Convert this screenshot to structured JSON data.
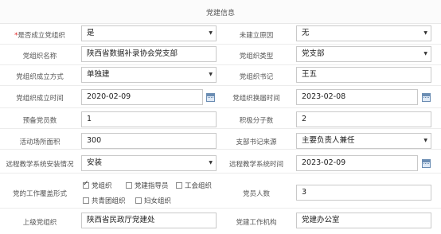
{
  "section_title": "党建信息",
  "rows": [
    {
      "left": {
        "label": "是否成立党组织",
        "required": "*",
        "value": "是",
        "type": "select"
      },
      "right": {
        "label": "未建立原因",
        "value": "无",
        "type": "select"
      }
    },
    {
      "left": {
        "label": "党组织名称",
        "value": "陕西省数据补录协会党支部",
        "type": "text"
      },
      "right": {
        "label": "党组织类型",
        "value": "党支部",
        "type": "select"
      }
    },
    {
      "left": {
        "label": "党组织成立方式",
        "value": "单独建",
        "type": "select"
      },
      "right": {
        "label": "党组织书记",
        "value": "王五",
        "type": "text"
      }
    },
    {
      "left": {
        "label": "党组织成立时间",
        "value": "2020-02-09",
        "type": "date"
      },
      "right": {
        "label": "党组织换届时间",
        "value": "2023-02-08",
        "type": "date"
      }
    },
    {
      "left": {
        "label": "预备党员数",
        "value": "1",
        "type": "text"
      },
      "right": {
        "label": "积极分子数",
        "value": "2",
        "type": "text"
      }
    },
    {
      "left": {
        "label": "活动场所面积",
        "value": "300",
        "type": "text"
      },
      "right": {
        "label": "支部书记来源",
        "value": "主要负责人兼任",
        "type": "select"
      }
    },
    {
      "left": {
        "label": "远程教学系统安装情况",
        "value": "安装",
        "type": "select"
      },
      "right": {
        "label": "远程教学系统时间",
        "value": "2023-02-09",
        "type": "date"
      }
    }
  ],
  "coverage": {
    "label": "党的工作覆盖形式",
    "options": [
      {
        "label": "党组织",
        "checked": true
      },
      {
        "label": "党建指导员",
        "checked": false
      },
      {
        "label": "工会组织",
        "checked": false
      },
      {
        "label": "共青团组织",
        "checked": false
      },
      {
        "label": "妇女组织",
        "checked": false
      }
    ]
  },
  "member_count": {
    "label": "党员人数",
    "value": "3"
  },
  "last_row": {
    "left": {
      "label": "上级党组织",
      "value": "陕西省民政厅党建处"
    },
    "right": {
      "label": "党建工作机构",
      "value": "党建办公室"
    }
  }
}
